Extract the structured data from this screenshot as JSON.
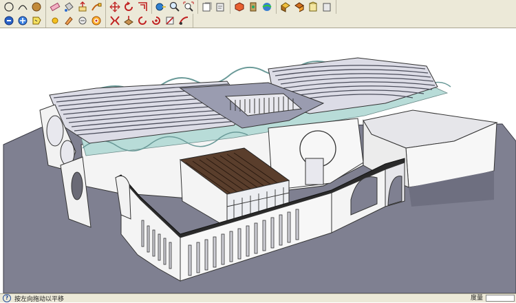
{
  "toolbar_row1": {
    "icons": [
      "circle-icon",
      "arc-icon",
      "orbit-icon",
      "eraser-icon",
      "paint-bucket-icon",
      "pushpull-icon",
      "follow-me-icon",
      "move-icon",
      "rotate-icon",
      "offset-icon",
      "tape-measure-icon",
      "zoom-icon",
      "zoom-extents-icon",
      "previous-view-icon",
      "next-view-icon",
      "iso-view-icon",
      "top-view-icon",
      "front-view-icon",
      "right-view-icon",
      "xray-icon",
      "wireframe-icon",
      "shaded-icon"
    ]
  },
  "toolbar_row2": {
    "icons": [
      "orbit-icon",
      "pan-icon",
      "paint-bucket-icon",
      "sun-icon",
      "eraser-icon",
      "walk-icon",
      "position-camera-icon",
      "section-plane-icon",
      "sandbox-icon",
      "drape-icon",
      "stamp-icon",
      "flip-edge-icon",
      "smoove-icon"
    ]
  },
  "status": {
    "hint": "按左向拖动以平移",
    "measurements_label": "度量"
  },
  "colors": {
    "sky": "#ffffff",
    "ground": "#7f8091",
    "walls": "#f4f4f4",
    "roof_lines": "#4a4c5a",
    "glass": "#b8dcd8",
    "plaza": "#9a9cb0",
    "pergola": "#5a3e2c"
  }
}
